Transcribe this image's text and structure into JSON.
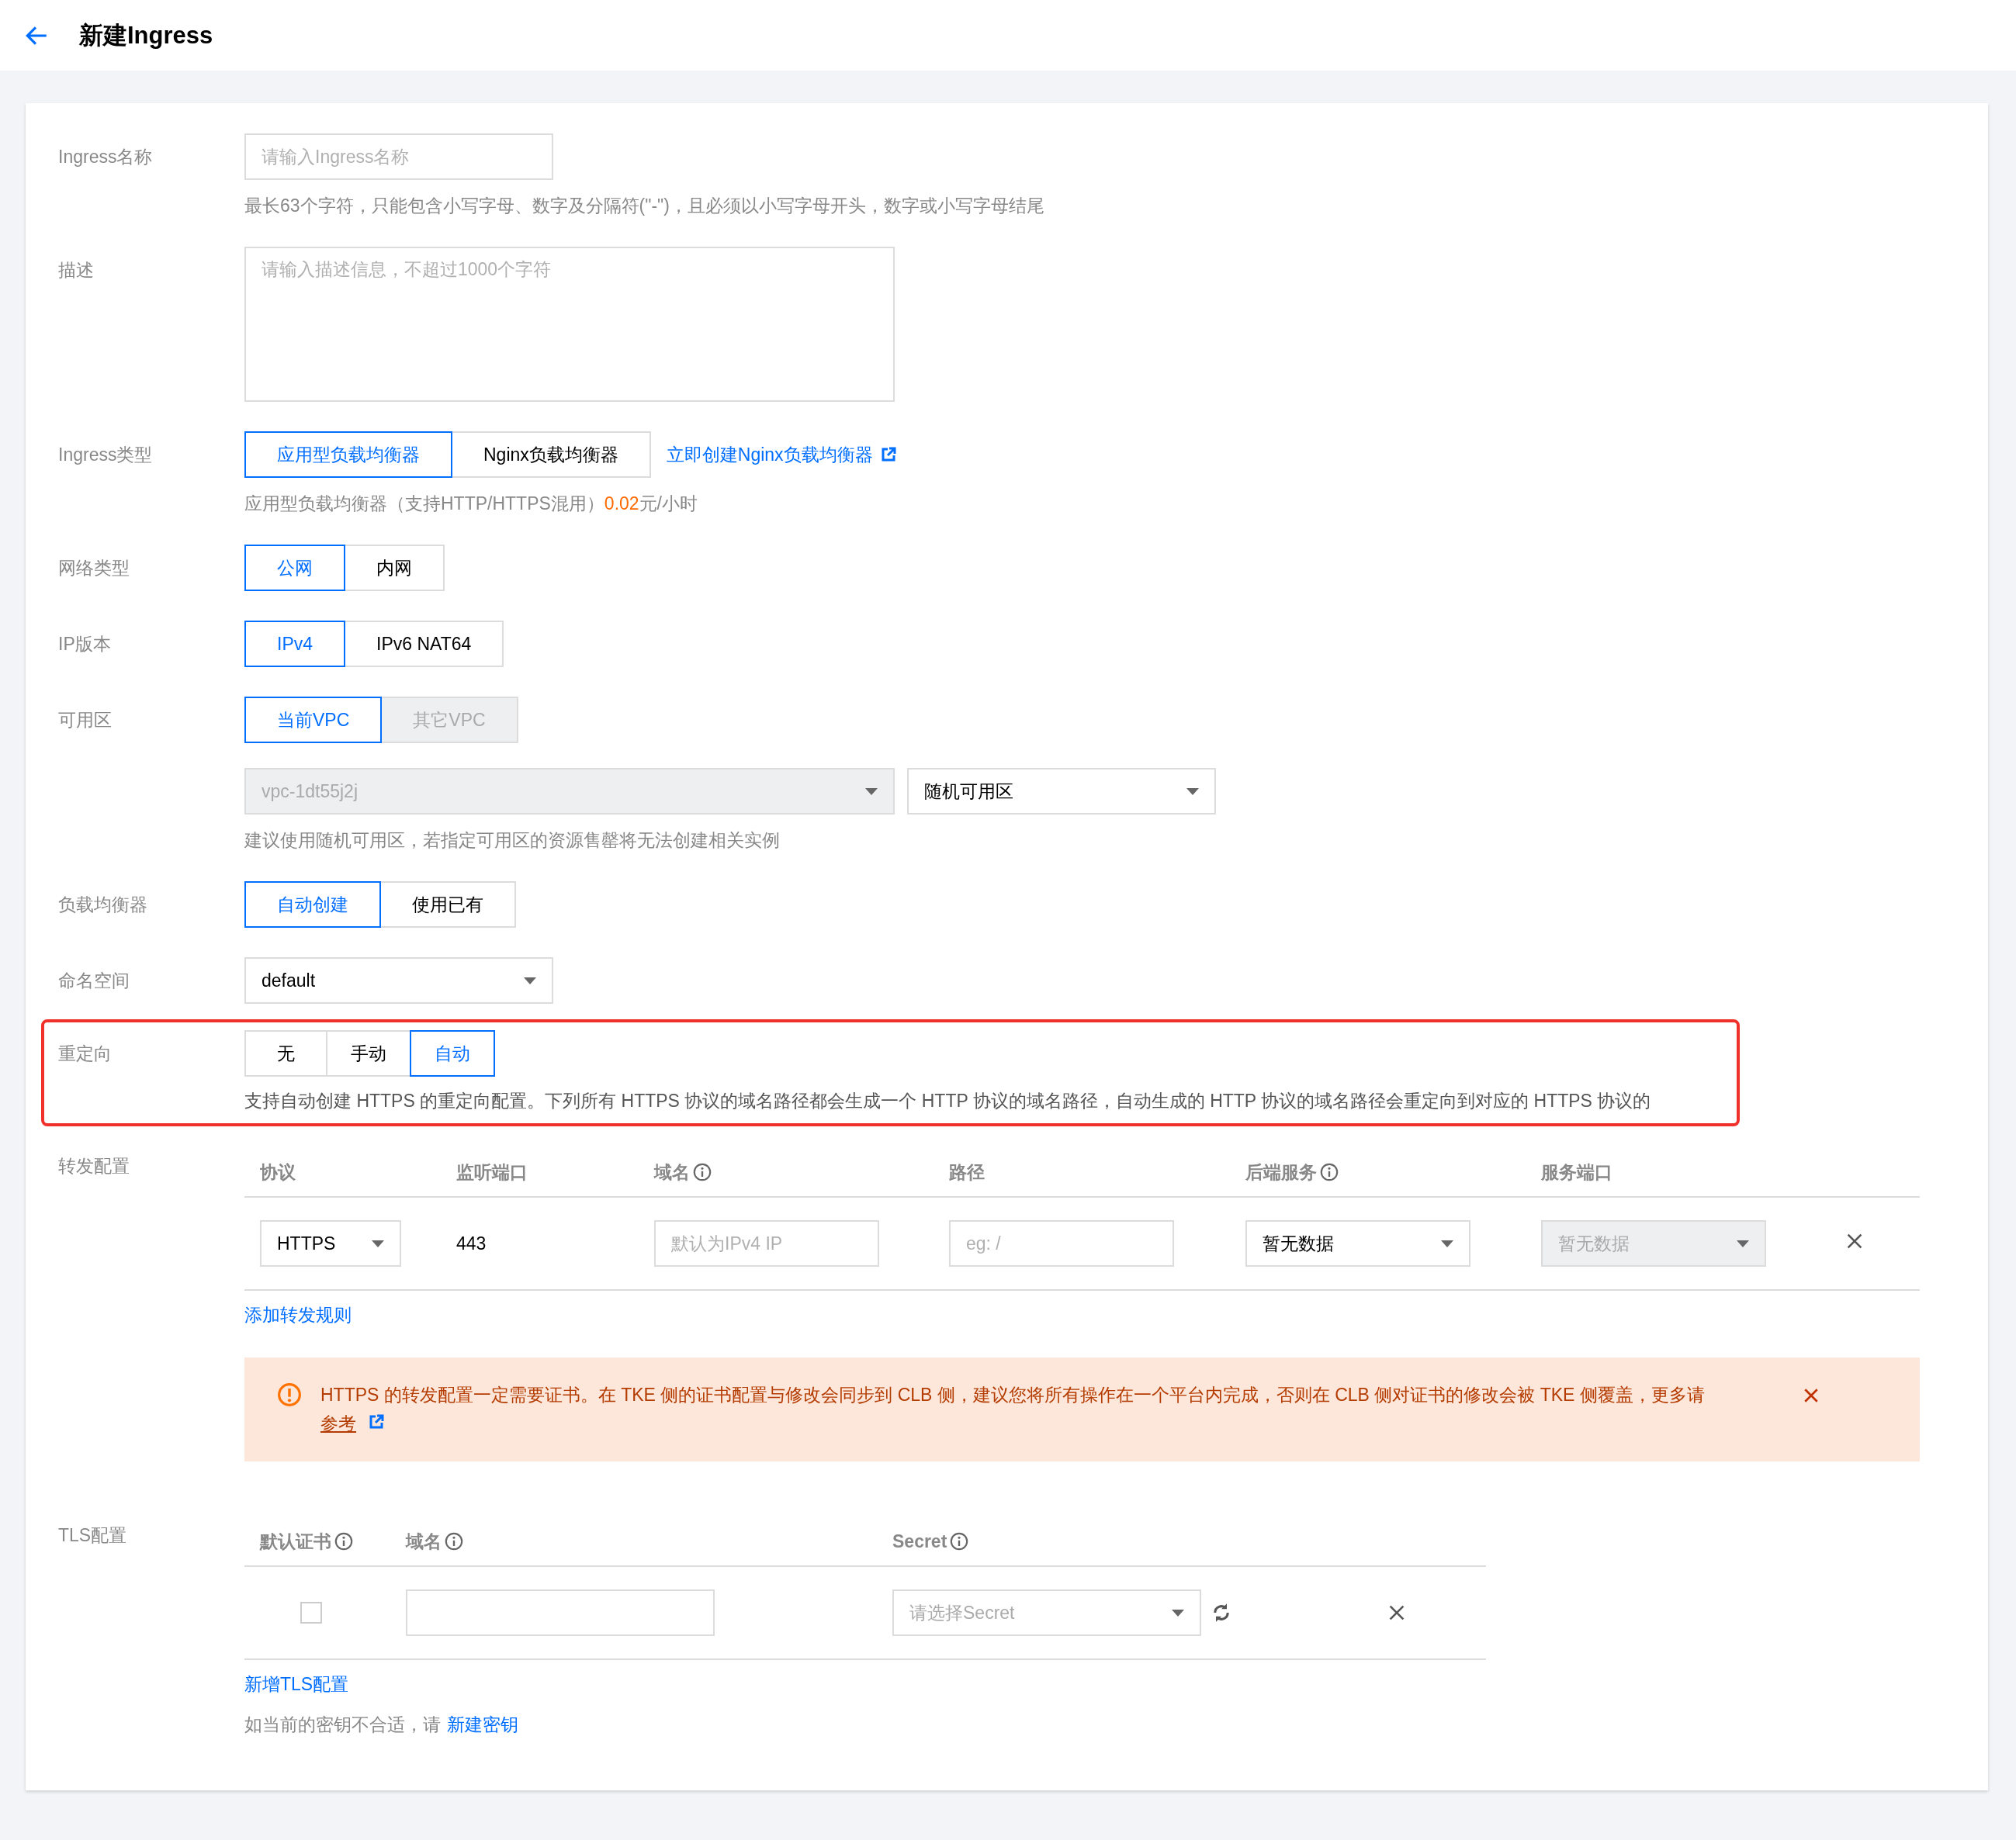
{
  "header": {
    "title": "新建Ingress"
  },
  "form": {
    "name": {
      "label": "Ingress名称",
      "placeholder": "请输入Ingress名称",
      "hint": "最长63个字符，只能包含小写字母、数字及分隔符(\"-\")，且必须以小写字母开头，数字或小写字母结尾"
    },
    "description": {
      "label": "描述",
      "placeholder": "请输入描述信息，不超过1000个字符"
    },
    "ingress_type": {
      "label": "Ingress类型",
      "options": [
        {
          "label": "应用型负载均衡器",
          "selected": true,
          "disabled": false
        },
        {
          "label": "Nginx负载均衡器",
          "selected": false,
          "disabled": false
        }
      ],
      "link": "立即创建Nginx负载均衡器",
      "hint_prefix": "应用型负载均衡器（支持HTTP/HTTPS混用）",
      "price": "0.02",
      "hint_suffix": "元/小时"
    },
    "network_type": {
      "label": "网络类型",
      "options": [
        {
          "label": "公网",
          "selected": true,
          "disabled": false
        },
        {
          "label": "内网",
          "selected": false,
          "disabled": false
        }
      ]
    },
    "ip_version": {
      "label": "IP版本",
      "options": [
        {
          "label": "IPv4",
          "selected": true,
          "disabled": false
        },
        {
          "label": "IPv6 NAT64",
          "selected": false,
          "disabled": false
        }
      ]
    },
    "zone": {
      "label": "可用区",
      "options": [
        {
          "label": "当前VPC",
          "selected": true,
          "disabled": false
        },
        {
          "label": "其它VPC",
          "selected": false,
          "disabled": true
        }
      ],
      "vpc_select": {
        "value": "vpc-1dt55j2j",
        "disabled": true
      },
      "zone_select": {
        "value": "随机可用区",
        "disabled": false
      },
      "hint": "建议使用随机可用区，若指定可用区的资源售罄将无法创建相关实例"
    },
    "load_balancer": {
      "label": "负载均衡器",
      "options": [
        {
          "label": "自动创建",
          "selected": true,
          "disabled": false
        },
        {
          "label": "使用已有",
          "selected": false,
          "disabled": false
        }
      ]
    },
    "namespace": {
      "label": "命名空间",
      "select": {
        "value": "default",
        "disabled": false
      }
    },
    "redirect": {
      "label": "重定向",
      "highlighted": true,
      "options": [
        {
          "label": "无",
          "selected": false,
          "disabled": false
        },
        {
          "label": "手动",
          "selected": false,
          "disabled": false
        },
        {
          "label": "自动",
          "selected": true,
          "disabled": false
        }
      ],
      "hint": "支持自动创建 HTTPS 的重定向配置。下列所有 HTTPS 协议的域名路径都会生成一个 HTTP 协议的域名路径，自动生成的 HTTP 协议的域名路径会重定向到对应的 HTTPS 协议的"
    },
    "forwarding": {
      "label": "转发配置",
      "columns": [
        {
          "label": "协议",
          "info": false
        },
        {
          "label": "监听端口",
          "info": false
        },
        {
          "label": "域名",
          "info": true
        },
        {
          "label": "路径",
          "info": false
        },
        {
          "label": "后端服务",
          "info": true
        },
        {
          "label": "服务端口",
          "info": false
        }
      ],
      "rows": [
        {
          "protocol": {
            "value": "HTTPS",
            "disabled": false
          },
          "port": "443",
          "domain_placeholder": "默认为IPv4 IP",
          "path_placeholder": "eg: /",
          "backend": {
            "value": "暂无数据",
            "disabled": false
          },
          "service_port": {
            "value": "暂无数据",
            "disabled": true
          }
        }
      ],
      "add_link": "添加转发规则",
      "alert": {
        "message": "HTTPS 的转发配置一定需要证书。在 TKE 侧的证书配置与修改会同步到 CLB 侧，建议您将所有操作在一个平台内完成，否则在 CLB 侧对证书的修改会被 TKE 侧覆盖，更多请",
        "link": "参考"
      }
    },
    "tls": {
      "label": "TLS配置",
      "columns": [
        {
          "label": "默认证书",
          "info": true
        },
        {
          "label": "域名",
          "info": true
        },
        {
          "label": "Secret",
          "info": true
        }
      ],
      "rows": [
        {
          "default": false,
          "secret_placeholder": "请选择Secret"
        }
      ],
      "add_link": "新增TLS配置",
      "hint": "如当前的密钥不合适，请",
      "hint_link": "新建密钥"
    }
  }
}
